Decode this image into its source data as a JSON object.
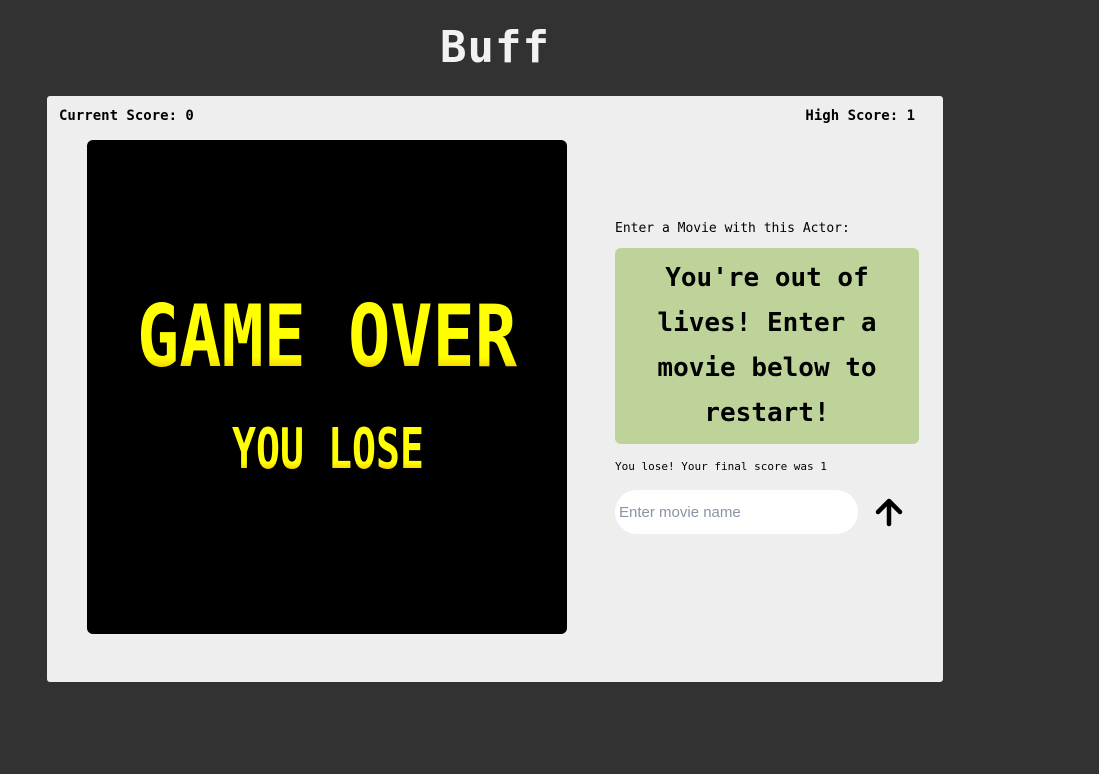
{
  "app": {
    "title": "Buff"
  },
  "scores": {
    "current_label": "Current Score: 0",
    "high_label": "High Score: 1"
  },
  "game_image": {
    "line1": "GAME OVER",
    "line2": "YOU LOSE",
    "text_color": "#ffff00",
    "shadow_color": "#c87000",
    "background": "#000000"
  },
  "main": {
    "prompt_label": "Enter a Movie with this Actor:",
    "actor_box_text": "You're out of lives! Enter a movie below to restart!",
    "result_message": "You lose! Your final score was 1",
    "input": {
      "placeholder": "Enter movie name",
      "value": ""
    },
    "submit_icon": "arrow-up-icon"
  },
  "colors": {
    "page_bg": "#323232",
    "card_bg": "#eeeeee",
    "actor_box_bg": "#bdd39a"
  }
}
